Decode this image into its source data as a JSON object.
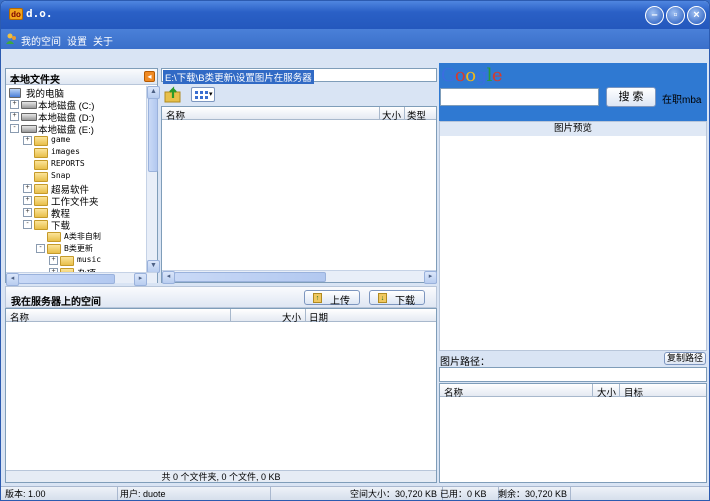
{
  "window": {
    "title": "d.o."
  },
  "menu": [
    "我的空间",
    "设置",
    "关于"
  ],
  "local": {
    "title": "本地文件夹",
    "tree": [
      {
        "label": "我的电脑",
        "type": "computer"
      },
      {
        "label": "本地磁盘 (C:)",
        "type": "drive"
      },
      {
        "label": "本地磁盘 (D:)",
        "type": "drive"
      },
      {
        "label": "本地磁盘 (E:)",
        "type": "drive"
      },
      {
        "label": "game",
        "type": "folder"
      },
      {
        "label": "images",
        "type": "folder"
      },
      {
        "label": "REPORTS",
        "type": "folder"
      },
      {
        "label": "Snap",
        "type": "folder"
      },
      {
        "label": "超易软件",
        "type": "folder"
      },
      {
        "label": "工作文件夹",
        "type": "folder"
      },
      {
        "label": "教程",
        "type": "folder"
      },
      {
        "label": "下载",
        "type": "folder"
      },
      {
        "label": "A类非自制",
        "type": "folder"
      },
      {
        "label": "B类更新",
        "type": "folder"
      },
      {
        "label": "music",
        "type": "folder"
      },
      {
        "label": "杂项",
        "type": "folder"
      }
    ],
    "path": "E:\\下载\\B类更新\\设置图片在服务器",
    "columns": {
      "name": "名称",
      "size": "大小",
      "type": "类型"
    }
  },
  "server": {
    "title": "我在服务器上的空间",
    "upload": "上传",
    "download": "下载",
    "columns": {
      "name": "名称",
      "size": "大小",
      "date": "日期"
    },
    "summary": "共 0 个文件夹, 0 个文件, 0 KB"
  },
  "google": {
    "logo": "Google",
    "search_button": "搜 索",
    "mba_label": "在职mba",
    "search_value": ""
  },
  "preview": {
    "title": "图片预览",
    "path_label": "图片路径：",
    "copy_button": "复制路径",
    "path_value": "",
    "columns": {
      "name": "名称",
      "size": "大小",
      "target": "目标"
    }
  },
  "status": {
    "version": "版本: 1.00",
    "user": "用户: duote",
    "space": "空间大小：30,720 KB",
    "used": "已用：0 KB",
    "remain": "剩余：30,720 KB"
  },
  "colors": {
    "title_blue": "#2a60c6",
    "frame": "#d9e4f4",
    "google_blue": "#3b7bd1"
  }
}
